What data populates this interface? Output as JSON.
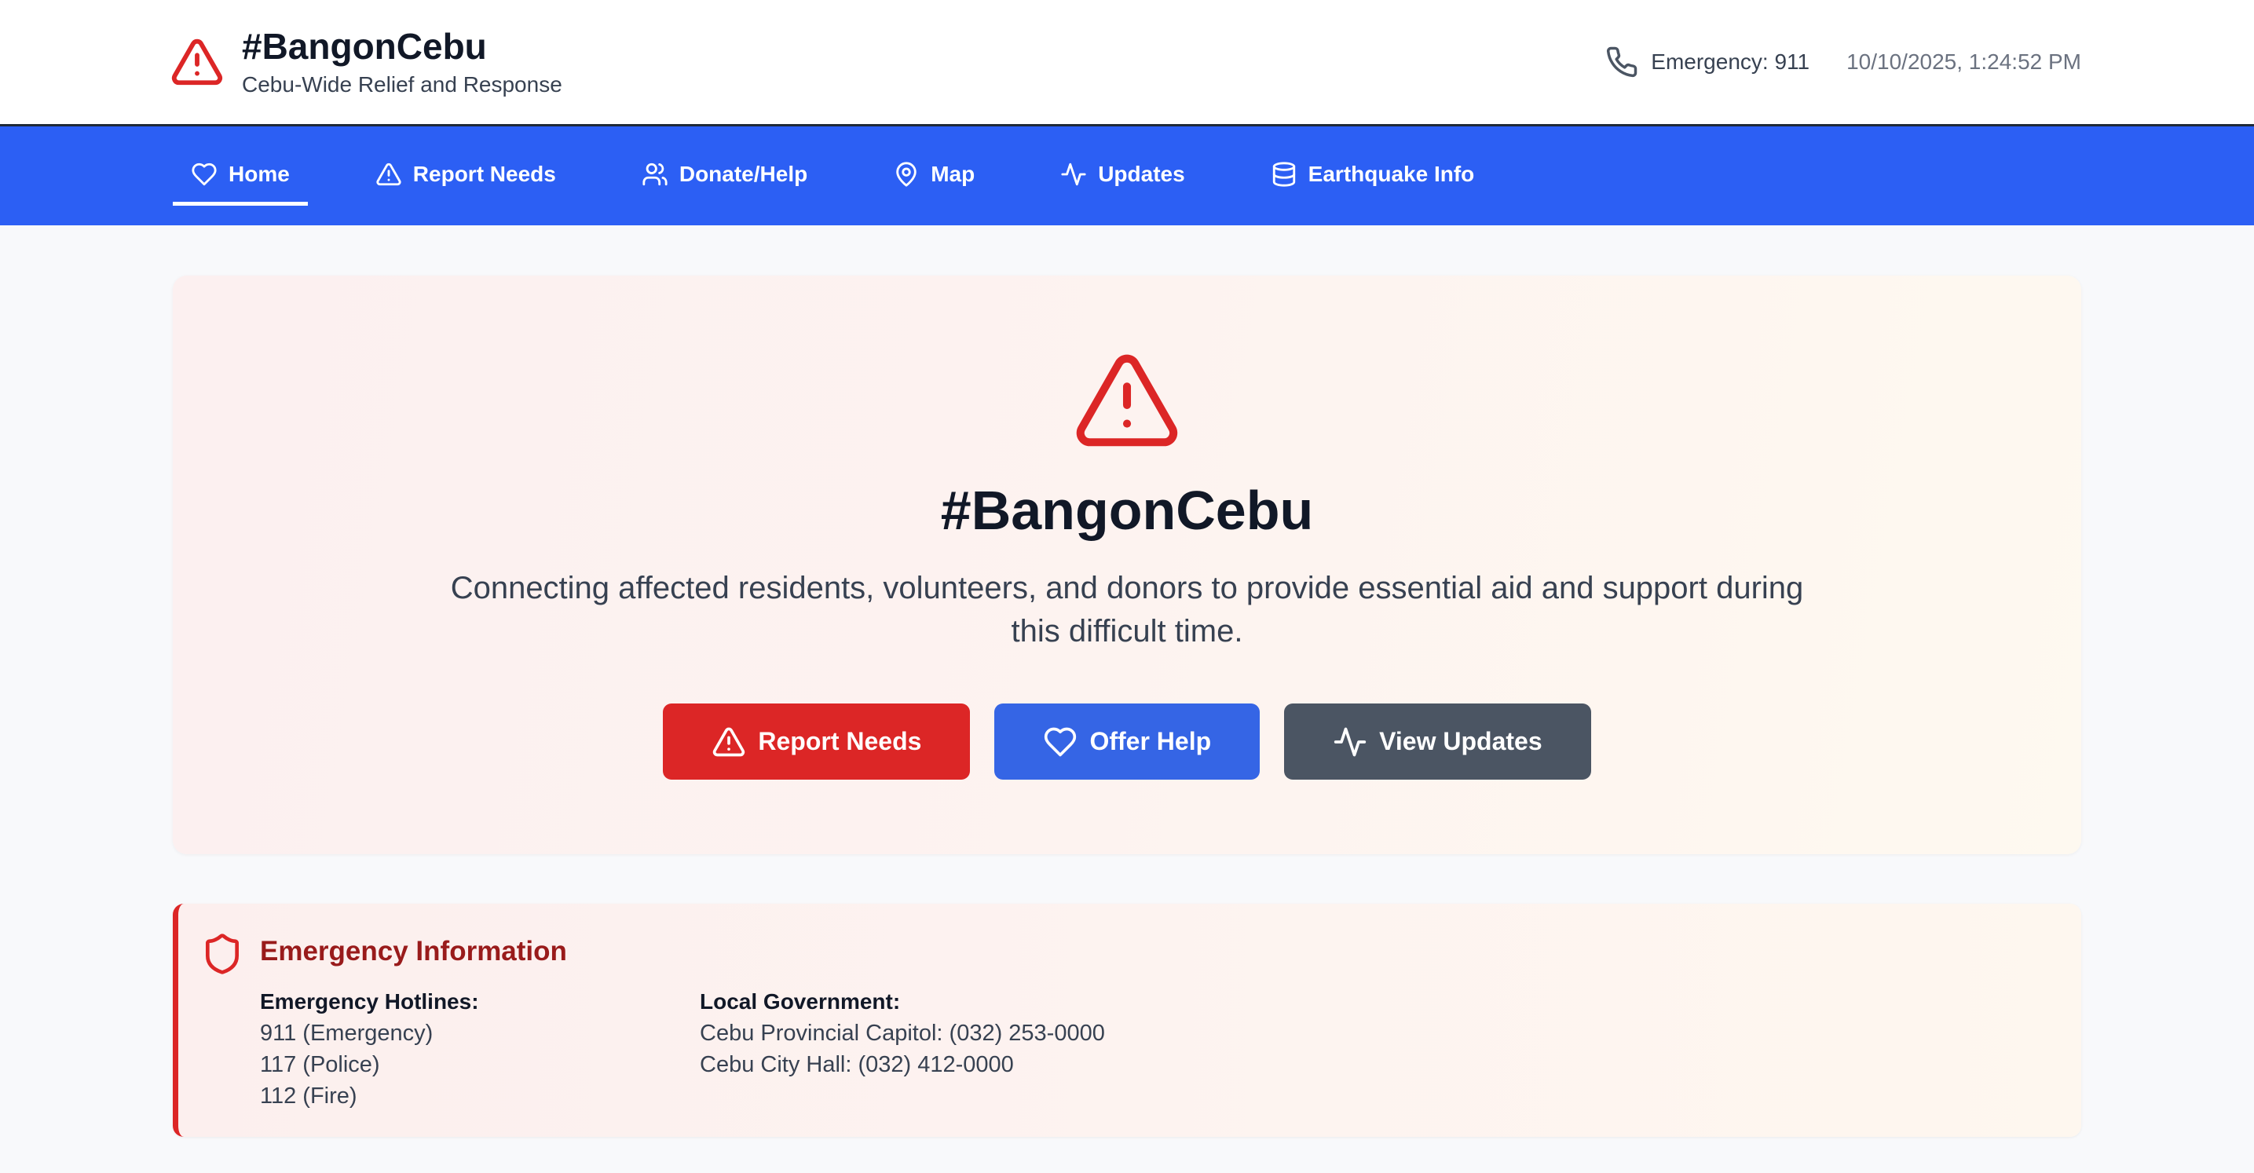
{
  "header": {
    "logo_icon": "alert-triangle-icon",
    "title": "#BangonCebu",
    "subtitle": "Cebu-Wide Relief and Response",
    "phone_icon": "phone-icon",
    "emergency_label": "Emergency: 911",
    "datetime": "10/10/2025, 1:24:52 PM"
  },
  "nav": {
    "items": [
      {
        "label": "Home",
        "icon": "heart-icon",
        "active": true
      },
      {
        "label": "Report Needs",
        "icon": "alert-triangle-icon",
        "active": false
      },
      {
        "label": "Donate/Help",
        "icon": "users-icon",
        "active": false
      },
      {
        "label": "Map",
        "icon": "map-pin-icon",
        "active": false
      },
      {
        "label": "Updates",
        "icon": "activity-icon",
        "active": false
      },
      {
        "label": "Earthquake Info",
        "icon": "database-icon",
        "active": false
      }
    ]
  },
  "hero": {
    "icon": "alert-triangle-icon",
    "title": "#BangonCebu",
    "description": "Connecting affected residents, volunteers, and donors to provide essential aid and support during this difficult time.",
    "buttons": [
      {
        "label": "Report Needs",
        "icon": "alert-triangle-icon",
        "color": "#dc2626"
      },
      {
        "label": "Offer Help",
        "icon": "heart-icon",
        "color": "#3565e5"
      },
      {
        "label": "View Updates",
        "icon": "activity-icon",
        "color": "#4b5563"
      }
    ]
  },
  "emergency": {
    "icon": "shield-icon",
    "title": "Emergency Information",
    "hotlines": {
      "heading": "Emergency Hotlines:",
      "items": [
        "911 (Emergency)",
        "117 (Police)",
        "112 (Fire)"
      ]
    },
    "government": {
      "heading": "Local Government:",
      "items": [
        "Cebu Provincial Capitol: (032) 253-0000",
        "Cebu City Hall: (032) 412-0000"
      ]
    }
  },
  "colors": {
    "nav_bg": "#2c5ff4",
    "accent_red": "#dc2626",
    "emergency_title": "#991b1b",
    "page_bg": "#f8f9fb"
  }
}
